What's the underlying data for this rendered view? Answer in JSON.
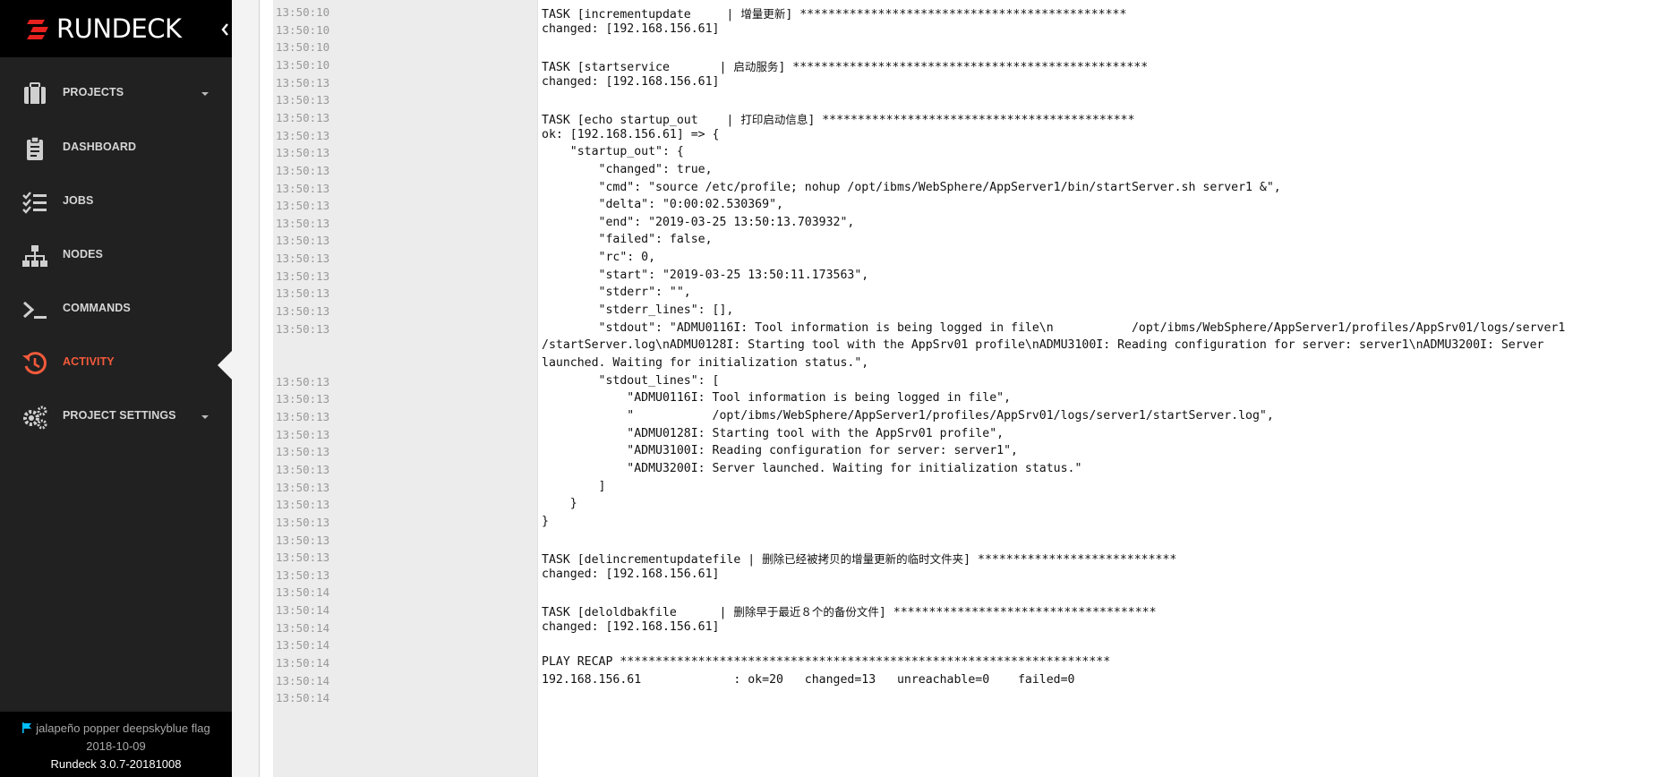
{
  "brand": {
    "name": "RUNDECK"
  },
  "nav": {
    "items": [
      {
        "label": "PROJECTS",
        "icon": "briefcase-icon",
        "has_dropdown": true
      },
      {
        "label": "DASHBOARD",
        "icon": "clipboard-icon",
        "has_dropdown": false
      },
      {
        "label": "JOBS",
        "icon": "list-check-icon",
        "has_dropdown": false
      },
      {
        "label": "NODES",
        "icon": "sitemap-icon",
        "has_dropdown": false
      },
      {
        "label": "COMMANDS",
        "icon": "terminal-icon",
        "has_dropdown": false
      },
      {
        "label": "ACTIVITY",
        "icon": "history-icon",
        "has_dropdown": false,
        "active": true
      },
      {
        "label": "PROJECT SETTINGS",
        "icon": "gears-icon",
        "has_dropdown": true
      }
    ],
    "active_color": "#f25a3b"
  },
  "footer": {
    "release_name": "jalapeño popper deepskyblue flag",
    "release_date": "2018-10-09",
    "version": "Rundeck 3.0.7-20181008",
    "flag_color": "#00bfff"
  },
  "log": {
    "lines": [
      {
        "time": "13:50:10",
        "text": "TASK [incrementupdate     | ",
        "cjk": "增量更新",
        "tail": "] **********************************************"
      },
      {
        "time": "13:50:10",
        "text": "changed: [192.168.156.61]"
      },
      {
        "time": "13:50:10",
        "text": ""
      },
      {
        "time": "13:50:10",
        "text": "TASK [startservice       | ",
        "cjk": "启动服务",
        "tail": "] **************************************************"
      },
      {
        "time": "13:50:13",
        "text": "changed: [192.168.156.61]"
      },
      {
        "time": "13:50:13",
        "text": ""
      },
      {
        "time": "13:50:13",
        "text": "TASK [echo startup_out    | ",
        "cjk": "打印启动信息",
        "tail": "] ********************************************"
      },
      {
        "time": "13:50:13",
        "text": "ok: [192.168.156.61] => {"
      },
      {
        "time": "13:50:13",
        "text": "    \"startup_out\": {"
      },
      {
        "time": "13:50:13",
        "text": "        \"changed\": true,"
      },
      {
        "time": "13:50:13",
        "text": "        \"cmd\": \"source /etc/profile; nohup /opt/ibms/WebSphere/AppServer1/bin/startServer.sh server1 &\","
      },
      {
        "time": "13:50:13",
        "text": "        \"delta\": \"0:00:02.530369\","
      },
      {
        "time": "13:50:13",
        "text": "        \"end\": \"2019-03-25 13:50:13.703932\","
      },
      {
        "time": "13:50:13",
        "text": "        \"failed\": false,"
      },
      {
        "time": "13:50:13",
        "text": "        \"rc\": 0,"
      },
      {
        "time": "13:50:13",
        "text": "        \"start\": \"2019-03-25 13:50:11.173563\","
      },
      {
        "time": "13:50:13",
        "text": "        \"stderr\": \"\","
      },
      {
        "time": "13:50:13",
        "text": "        \"stderr_lines\": [],"
      },
      {
        "time": "13:50:13",
        "text": "        \"stdout\": \"ADMU0116I: Tool information is being logged in file\\n           /opt/ibms/WebSphere/AppServer1/profiles/AppSrv01/logs/server1"
      },
      {
        "time": "",
        "text": "/startServer.log\\nADMU0128I: Starting tool with the AppSrv01 profile\\nADMU3100I: Reading configuration for server: server1\\nADMU3200I: Server"
      },
      {
        "time": "",
        "text": "launched. Waiting for initialization status.\","
      },
      {
        "time": "13:50:13",
        "text": "        \"stdout_lines\": ["
      },
      {
        "time": "13:50:13",
        "text": "            \"ADMU0116I: Tool information is being logged in file\","
      },
      {
        "time": "13:50:13",
        "text": "            \"           /opt/ibms/WebSphere/AppServer1/profiles/AppSrv01/logs/server1/startServer.log\","
      },
      {
        "time": "13:50:13",
        "text": "            \"ADMU0128I: Starting tool with the AppSrv01 profile\","
      },
      {
        "time": "13:50:13",
        "text": "            \"ADMU3100I: Reading configuration for server: server1\","
      },
      {
        "time": "13:50:13",
        "text": "            \"ADMU3200I: Server launched. Waiting for initialization status.\""
      },
      {
        "time": "13:50:13",
        "text": "        ]"
      },
      {
        "time": "13:50:13",
        "text": "    }"
      },
      {
        "time": "13:50:13",
        "text": "}"
      },
      {
        "time": "13:50:13",
        "text": ""
      },
      {
        "time": "13:50:13",
        "text": "TASK [delincrementupdatefile | ",
        "cjk": "删除已经被拷贝的增量更新的临时文件夹",
        "tail": "] ****************************"
      },
      {
        "time": "13:50:13",
        "text": "changed: [192.168.156.61]"
      },
      {
        "time": "13:50:14",
        "text": ""
      },
      {
        "time": "13:50:14",
        "text": "TASK [deloldbakfile      | ",
        "cjk": "删除早于最近８个的备份文件",
        "tail": "] *************************************"
      },
      {
        "time": "13:50:14",
        "text": "changed: [192.168.156.61]"
      },
      {
        "time": "13:50:14",
        "text": ""
      },
      {
        "time": "13:50:14",
        "text": "PLAY RECAP *********************************************************************"
      },
      {
        "time": "13:50:14",
        "text": "192.168.156.61             : ok=20   changed=13   unreachable=0    failed=0"
      },
      {
        "time": "13:50:14",
        "text": ""
      }
    ]
  }
}
